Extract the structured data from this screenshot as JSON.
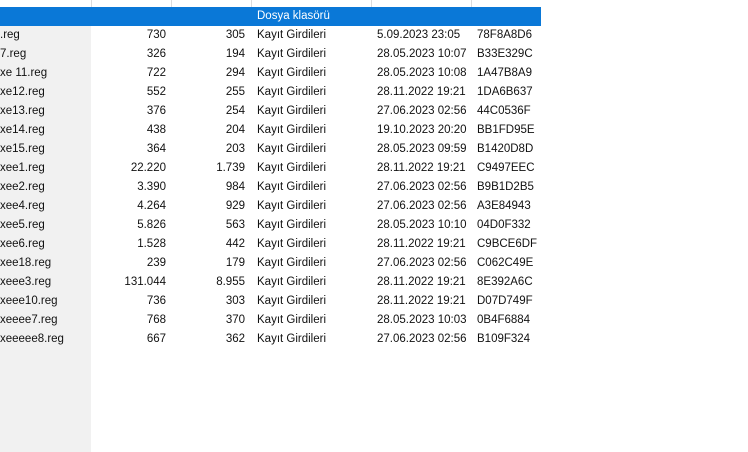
{
  "header_separators": [
    91,
    171,
    251,
    371,
    471
  ],
  "selected_row": {
    "name": "",
    "type": "Dosya klasörü"
  },
  "rows": [
    {
      "name": ".reg",
      "size": "730",
      "packed": "305",
      "type": "Kayıt Girdileri",
      "modified": "5.09.2023 23:05",
      "crc": "78F8A8D6"
    },
    {
      "name": "7.reg",
      "size": "326",
      "packed": "194",
      "type": "Kayıt Girdileri",
      "modified": "28.05.2023 10:07",
      "crc": "B33E329C"
    },
    {
      "name": "xe 11.reg",
      "size": "722",
      "packed": "294",
      "type": "Kayıt Girdileri",
      "modified": "28.05.2023 10:08",
      "crc": "1A47B8A9"
    },
    {
      "name": "xe12.reg",
      "size": "552",
      "packed": "255",
      "type": "Kayıt Girdileri",
      "modified": "28.11.2022 19:21",
      "crc": "1DA6B637"
    },
    {
      "name": "xe13.reg",
      "size": "376",
      "packed": "254",
      "type": "Kayıt Girdileri",
      "modified": "27.06.2023 02:56",
      "crc": "44C0536F"
    },
    {
      "name": "xe14.reg",
      "size": "438",
      "packed": "204",
      "type": "Kayıt Girdileri",
      "modified": "19.10.2023 20:20",
      "crc": "BB1FD95E"
    },
    {
      "name": "xe15.reg",
      "size": "364",
      "packed": "203",
      "type": "Kayıt Girdileri",
      "modified": "28.05.2023 09:59",
      "crc": "B1420D8D"
    },
    {
      "name": "xee1.reg",
      "size": "22.220",
      "packed": "1.739",
      "type": "Kayıt Girdileri",
      "modified": "28.11.2022 19:21",
      "crc": "C9497EEC"
    },
    {
      "name": "xee2.reg",
      "size": "3.390",
      "packed": "984",
      "type": "Kayıt Girdileri",
      "modified": "27.06.2023 02:56",
      "crc": "B9B1D2B5"
    },
    {
      "name": "xee4.reg",
      "size": "4.264",
      "packed": "929",
      "type": "Kayıt Girdileri",
      "modified": "27.06.2023 02:56",
      "crc": "A3E84943"
    },
    {
      "name": "xee5.reg",
      "size": "5.826",
      "packed": "563",
      "type": "Kayıt Girdileri",
      "modified": "28.05.2023 10:10",
      "crc": "04D0F332"
    },
    {
      "name": "xee6.reg",
      "size": "1.528",
      "packed": "442",
      "type": "Kayıt Girdileri",
      "modified": "28.11.2022 19:21",
      "crc": "C9BCE6DF"
    },
    {
      "name": "xee18.reg",
      "size": "239",
      "packed": "179",
      "type": "Kayıt Girdileri",
      "modified": "27.06.2023 02:56",
      "crc": "C062C49E"
    },
    {
      "name": "xeee3.reg",
      "size": "131.044",
      "packed": "8.955",
      "type": "Kayıt Girdileri",
      "modified": "28.11.2022 19:21",
      "crc": "8E392A6C"
    },
    {
      "name": "xeee10.reg",
      "size": "736",
      "packed": "303",
      "type": "Kayıt Girdileri",
      "modified": "28.11.2022 19:21",
      "crc": "D07D749F"
    },
    {
      "name": "xeeee7.reg",
      "size": "768",
      "packed": "370",
      "type": "Kayıt Girdileri",
      "modified": "28.05.2023 10:03",
      "crc": "0B4F6884"
    },
    {
      "name": "xeeeee8.reg",
      "size": "667",
      "packed": "362",
      "type": "Kayıt Girdileri",
      "modified": "27.06.2023 02:56",
      "crc": "B109F324"
    }
  ]
}
